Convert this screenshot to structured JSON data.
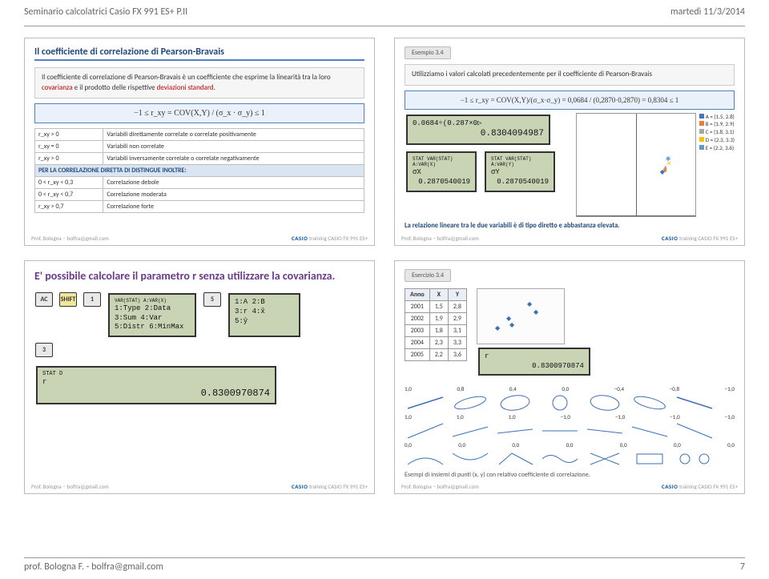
{
  "header": {
    "left": "Seminario calcolatrici Casio FX 991 ES+ P.II",
    "right": "martedì 11/3/2014"
  },
  "footer": {
    "left": "prof. Bologna F. - bolfra@gmail.com",
    "right": "7"
  },
  "slide_footer": {
    "left": "Prof. Bologna – bolfra@gmail.com",
    "center": "training CASIO FX 991 ES+"
  },
  "slideA": {
    "title": "Il coefficiente di correlazione di Pearson-Bravais",
    "def_pre": "Il coefficiente di correlazione di Pearson-Bravais è un coefficiente che esprime la linearità tra la loro ",
    "def_red1": "covarianza",
    "def_mid": " e il prodotto delle rispettive ",
    "def_red2": "deviazioni standard",
    "def_end": ".",
    "formula": "−1 ≤ r_xy = COV(X,Y) / (σ_x · σ_y) ≤ 1",
    "rows": [
      {
        "cond": "r_xy > 0",
        "desc": "Variabili direttamente correlate o correlate positivamente"
      },
      {
        "cond": "r_xy = 0",
        "desc": "Variabili non correlate"
      },
      {
        "cond": "r_xy > 0",
        "desc": "Variabili inversamente correlate o correlate negativamente"
      }
    ],
    "sub_header": "PER LA CORRELAZIONE DIRETTA DI DISTINGUE INOLTRE:",
    "ranges": [
      {
        "cond": "0 < r_xy < 0,3",
        "desc": "Correlazione debole"
      },
      {
        "cond": "0 < r_xy < 0,7",
        "desc": "Correlazione moderata"
      },
      {
        "cond": "r_xy > 0,7",
        "desc": "Correlazione forte"
      }
    ]
  },
  "slideB": {
    "tag": "Esempio 3.4",
    "intro": "Utilizziamo i valori calcolati precedentemente per il coefficiente di Pearson-Bravais",
    "formula": "−1 ≤ r_xy = COV(X,Y)/(σ_x·σ_y) = 0,0684 / (0,2870·0,2870) = 0,8304 ≤ 1",
    "calc1_line1": "0.0684÷(0.287×0▷",
    "calc1_line2": "0.8304094987",
    "calc2_label1": "STAT        VAR(STAT) A:VAR(X)",
    "calc2_val1": "σX",
    "calc2_num1": "0.2870540019",
    "calc2_label2": "STAT        VAR(STAT) A:VAR(Y)",
    "calc2_val2": "σY",
    "calc2_num2": "0.2870540019",
    "chart_data": {
      "type": "scatter",
      "xlim": [
        -5,
        5
      ],
      "ylim": [
        0,
        6
      ],
      "series": [
        {
          "name": "A = (1.5, 2.8)",
          "color": "#4472c4",
          "x": 1.5,
          "y": 2.8
        },
        {
          "name": "B = (1.9, 2.9)",
          "color": "#ed7d31",
          "x": 1.9,
          "y": 2.9
        },
        {
          "name": "C = (1.8, 3.1)",
          "color": "#a5a5a5",
          "x": 1.8,
          "y": 3.1
        },
        {
          "name": "D = (2.3, 3.3)",
          "color": "#ffc000",
          "x": 2.3,
          "y": 3.3
        },
        {
          "name": "E = (2.2, 3.6)",
          "color": "#5b9bd5",
          "x": 2.2,
          "y": 3.6
        }
      ],
      "y_ticks": [
        1,
        2,
        3,
        4,
        5,
        6
      ],
      "x_ticks": [
        -5,
        -4,
        -3,
        -2,
        -1,
        1,
        2,
        3,
        4,
        5
      ]
    },
    "conclusion": "La relazione lineare tra le due variabili è di tipo diretto e abbastanza elevata."
  },
  "slideC": {
    "title": "E' possibile calcolare il parametro r senza utilizzare la covarianza.",
    "keys1": [
      "AC",
      "SHIFT",
      "1"
    ],
    "menu1_l1": "VAR(STAT) A:VAR(X)",
    "menu1_l2": "1:Type  2:Data",
    "menu1_l3": "3:Sum   4:Var",
    "menu1_l4": "5:Distr 6:MinMax",
    "keys2": [
      "5"
    ],
    "menu2_l1": "1:A   2:B",
    "menu2_l2": "3:r   4:x̂",
    "menu2_l3": "5:ŷ",
    "keys3": [
      "3"
    ],
    "result_label": "r",
    "result_header": "STAT                                  D",
    "result_value": "0.8300970874"
  },
  "slideD": {
    "tag": "Esercizio 3.4",
    "table": {
      "headers": [
        "Anno",
        "X",
        "Y"
      ],
      "rows": [
        [
          "2001",
          "1,5",
          "2,8"
        ],
        [
          "2002",
          "1,9",
          "2,9"
        ],
        [
          "2003",
          "1,8",
          "3,1"
        ],
        [
          "2004",
          "2,3",
          "3,3"
        ],
        [
          "2005",
          "2,2",
          "3,6"
        ]
      ]
    },
    "r_screen_label": "r",
    "r_screen_val": "0.8300970874",
    "row_r": [
      "1,0",
      "0,8",
      "0,4",
      "0,0",
      "−0,4",
      "−0,8",
      "−1,0"
    ],
    "row_r2": [
      "1,0",
      "1,0",
      "1,0",
      "−1,0",
      "−1,0",
      "−1,0",
      "−1,0"
    ],
    "row_r3": [
      "0,0",
      "0,0",
      "0,0",
      "0,0",
      "0,0",
      "0,0",
      "0,0"
    ],
    "caption": "Esempi di insiemi di punti (x, y) con relativo coefficiente di correlazione."
  }
}
